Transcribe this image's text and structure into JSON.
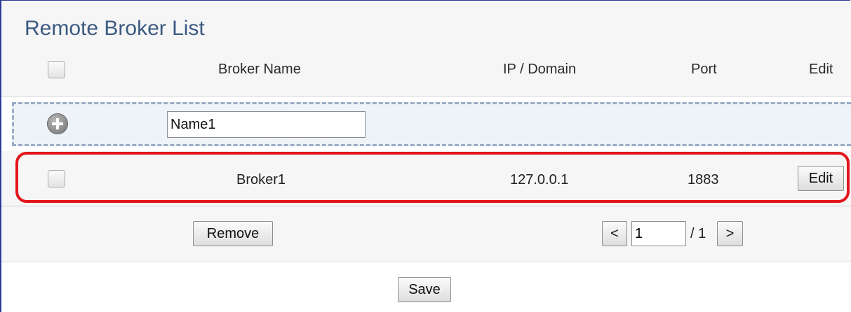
{
  "title": "Remote Broker List",
  "table": {
    "headers": {
      "broker_name": "Broker Name",
      "ip_domain": "IP / Domain",
      "port": "Port",
      "edit": "Edit"
    },
    "new_entry": {
      "name_value": "Name1"
    },
    "rows": [
      {
        "broker_name": "Broker1",
        "ip_domain": "127.0.0.1",
        "port": "1883",
        "edit_label": "Edit"
      }
    ]
  },
  "footer": {
    "remove_label": "Remove",
    "prev_label": "<",
    "page_value": "1",
    "page_total": "/ 1",
    "next_label": ">"
  },
  "save_label": "Save",
  "colors": {
    "title": "#3c5a82",
    "highlight": "#e3141b",
    "add_row_bg": "#eef3f8",
    "add_row_border": "#9aadc6",
    "frame": "#2a3a9a"
  },
  "icons": {
    "add": "plus-circle-icon"
  }
}
